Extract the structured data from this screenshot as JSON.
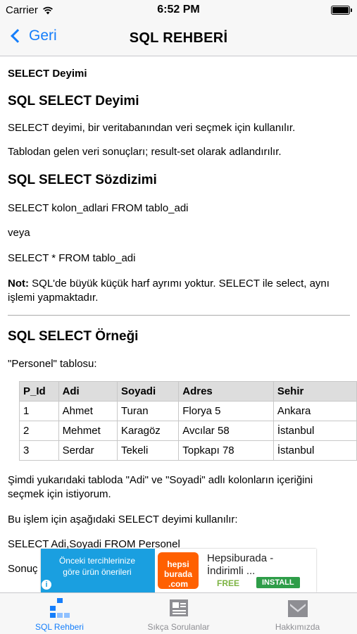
{
  "status_bar": {
    "carrier": "Carrier",
    "time": "6:52 PM"
  },
  "nav": {
    "back_label": "Geri",
    "title": "SQL REHBERİ"
  },
  "content": {
    "section_label": "SELECT Deyimi",
    "heading1": "SQL SELECT Deyimi",
    "p1": "SELECT deyimi, bir veritabanından veri seçmek için kullanılır.",
    "p2": "Tablodan gelen veri sonuçları; result-set olarak adlandırılır.",
    "heading2": "SQL SELECT Sözdizimi",
    "syntax1": "SELECT kolon_adlari FROM tablo_adi",
    "or": "veya",
    "syntax2": "SELECT * FROM tablo_adi",
    "note_label": "Not:",
    "note_text": " SQL'de büyük küçük harf ayrımı yoktur. SELECT ile select, aynı işlemi yapmaktadır.",
    "heading3": "SQL SELECT Örneği",
    "table_caption": "\"Personel\" tablosu:",
    "table": {
      "headers": [
        "P_Id",
        "Adi",
        "Soyadi",
        "Adres",
        "Sehir"
      ],
      "rows": [
        [
          "1",
          "Ahmet",
          "Turan",
          "Florya 5",
          "Ankara"
        ],
        [
          "2",
          "Mehmet",
          "Karagöz",
          "Avcılar 58",
          "İstanbul"
        ],
        [
          "3",
          "Serdar",
          "Tekeli",
          "Topkapı 78",
          "İstanbul"
        ]
      ]
    },
    "p3": "Şimdi yukarıdaki tabloda \"Adi\" ve \"Soyadi\" adlı kolonların içeriğini seçmek için istiyorum.",
    "p4": "Bu işlem için aşağıdaki SELECT deyimi kullanılır:",
    "query": "SELECT Adi,Soyadi FROM Personel",
    "p5_partial": "Sonuç"
  },
  "ad": {
    "left_text": "Önceki tercihlerinize göre ürün önerileri",
    "logo_text": "hepsi burada .com",
    "title": "Hepsiburada -",
    "title2": "İndirimli ...",
    "free": "FREE",
    "install": "INSTALL",
    "info": "i"
  },
  "tabs": [
    {
      "label": "SQL Rehberi",
      "icon": "hierarchy-icon",
      "active": true
    },
    {
      "label": "Sıkça Sorulanlar",
      "icon": "newspaper-icon",
      "active": false
    },
    {
      "label": "Hakkımızda",
      "icon": "inbox-icon",
      "active": false
    }
  ],
  "colors": {
    "accent": "#157efb",
    "inactive": "#8e8e93",
    "table_header": "#dddddd"
  }
}
